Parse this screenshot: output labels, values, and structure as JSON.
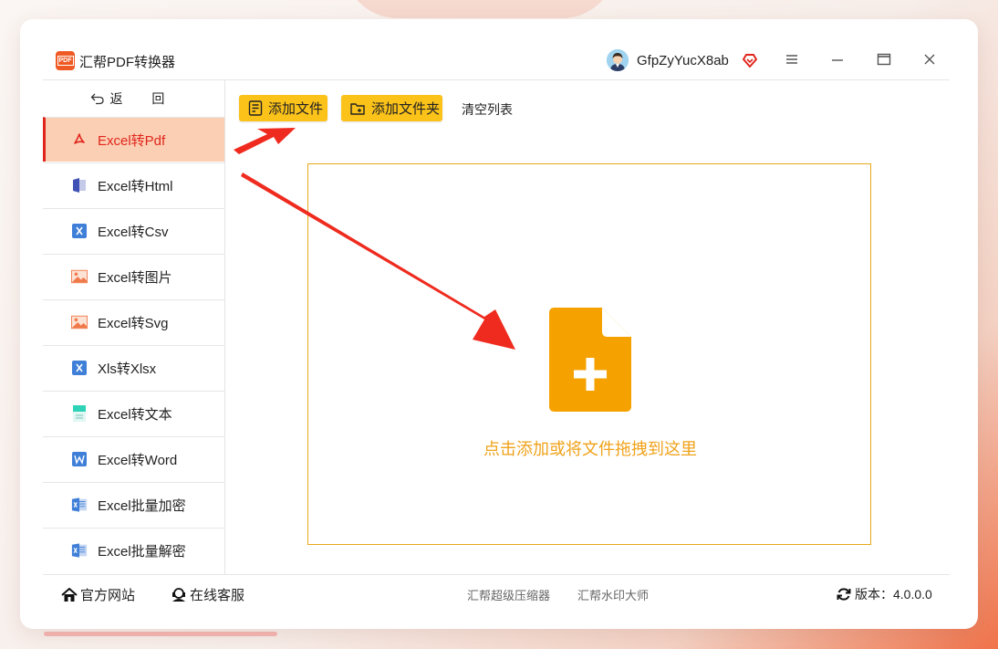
{
  "app": {
    "title": "汇帮PDF转换器",
    "logo_text": "PDF",
    "username": "GfpZyYucX8ab"
  },
  "sidebar": {
    "back_label": "返 回",
    "items": [
      {
        "label": "Excel转Pdf",
        "icon": "pdf-icon",
        "active": true
      },
      {
        "label": "Excel转Html",
        "icon": "html-icon"
      },
      {
        "label": "Excel转Csv",
        "icon": "csv-icon"
      },
      {
        "label": "Excel转图片",
        "icon": "image-icon"
      },
      {
        "label": "Excel转Svg",
        "icon": "svg-icon"
      },
      {
        "label": "Xls转Xlsx",
        "icon": "xlsx-icon"
      },
      {
        "label": "Excel转文本",
        "icon": "text-icon"
      },
      {
        "label": "Excel转Word",
        "icon": "word-icon"
      },
      {
        "label": "Excel批量加密",
        "icon": "excel-lock-icon"
      },
      {
        "label": "Excel批量解密",
        "icon": "excel-unlock-icon"
      }
    ]
  },
  "toolbar": {
    "add_file": "添加文件",
    "add_folder": "添加文件夹",
    "clear_list": "清空列表"
  },
  "dropzone": {
    "hint": "点击添加或将文件拖拽到这里"
  },
  "footer": {
    "website": "官方网站",
    "support": "在线客服",
    "link_compressor": "汇帮超级压缩器",
    "link_watermark": "汇帮水印大师",
    "version": "版本：4.0.0.0"
  },
  "colors": {
    "accent_orange": "#f0a21a",
    "button_yellow": "#fbc21a",
    "active_red": "#e0251d",
    "active_bg": "#fbcfb3"
  }
}
